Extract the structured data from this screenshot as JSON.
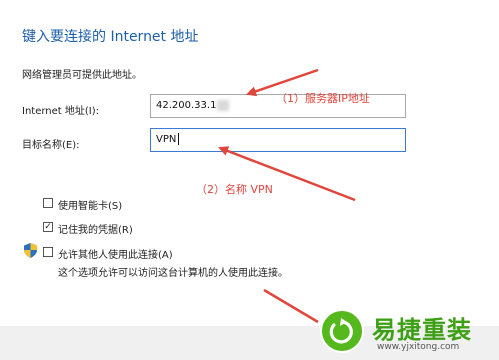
{
  "dialog": {
    "title": "键入要连接的 Internet 地址",
    "description": "网络管理员可提供此地址。",
    "internet_address": {
      "label": "Internet 地址(I):",
      "value": "42.200.33.1"
    },
    "destination_name": {
      "label": "目标名称(E):",
      "value": "VPN"
    },
    "use_smart_card": {
      "label": "使用智能卡(S)",
      "checked": false
    },
    "remember_credentials": {
      "label": "记住我的凭据(R)",
      "checked": true
    },
    "allow_others": {
      "label": "允许其他人使用此连接(A)",
      "checked": false,
      "note": "这个选项允许可以访问这台计算机的人使用此连接。"
    }
  },
  "annotations": {
    "server_ip": "（1）服务器IP地址",
    "name_vpn": "（2）名称 VPN"
  },
  "watermark": {
    "brand": "易捷重装",
    "url": "www.yjxitong.com"
  },
  "colors": {
    "title": "#1d5fa8",
    "annotation": "#e0463c",
    "brand_green": "#55b81c"
  },
  "icons": {
    "shield": "uac-shield-icon",
    "check": "check-icon"
  }
}
